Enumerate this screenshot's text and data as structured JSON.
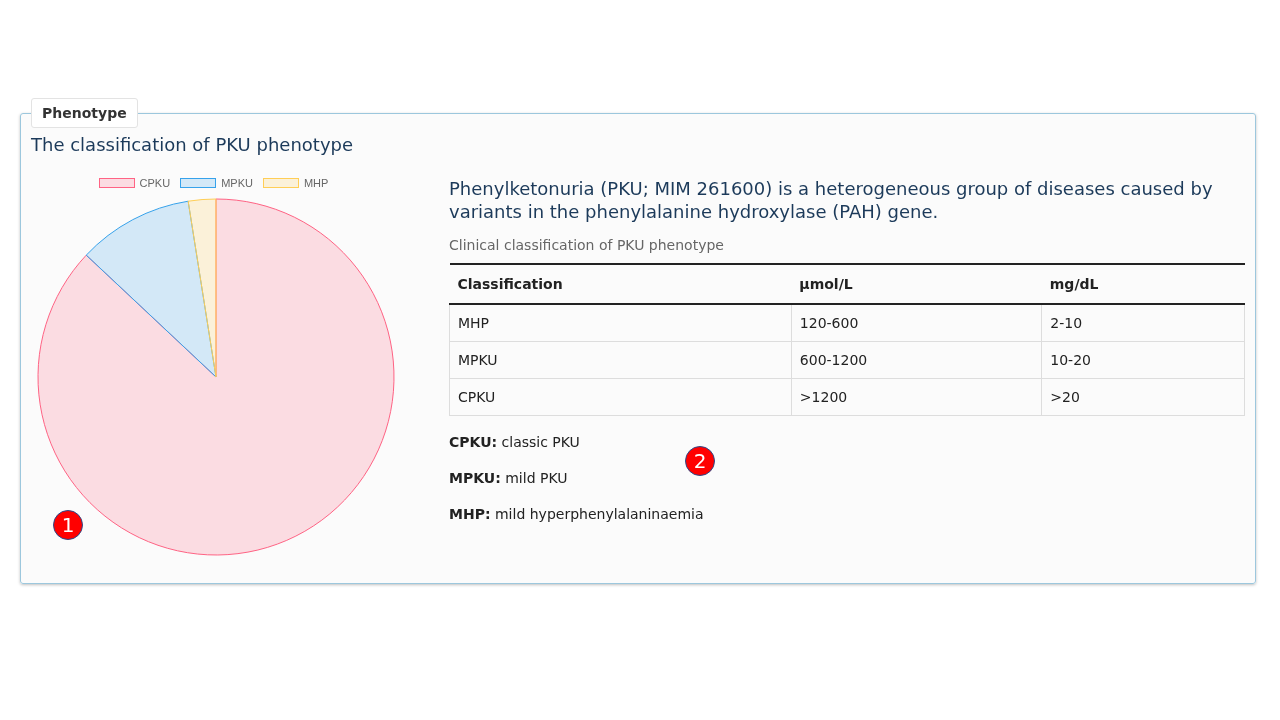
{
  "panel": {
    "legend": "Phenotype",
    "heading": "The classification of PKU phenotype"
  },
  "pie_legend": [
    {
      "label": "CPKU",
      "color": "#ff6384"
    },
    {
      "label": "MPKU",
      "color": "#36a2eb"
    },
    {
      "label": "MHP",
      "color": "#ffce56"
    }
  ],
  "intro": "Phenylketonuria (PKU; MIM 261600) is a heterogeneous group of diseases caused by variants in the phenylalanine hydroxylase (PAH) gene.",
  "table": {
    "caption": "Clinical classification of PKU phenotype",
    "columns": [
      "Classification",
      "µmol/L",
      "mg/dL"
    ],
    "rows": [
      [
        "MHP",
        "120-600",
        "2-10"
      ],
      [
        "MPKU",
        "600-1200",
        "10-20"
      ],
      [
        "CPKU",
        ">1200",
        ">20"
      ]
    ]
  },
  "definitions": [
    "**CPKU:** classic PKU",
    "**MPKU:** mild PKU",
    "**MHP:** mild hyperphenylalaninaemia"
  ],
  "markers": [
    "1",
    "2"
  ]
}
